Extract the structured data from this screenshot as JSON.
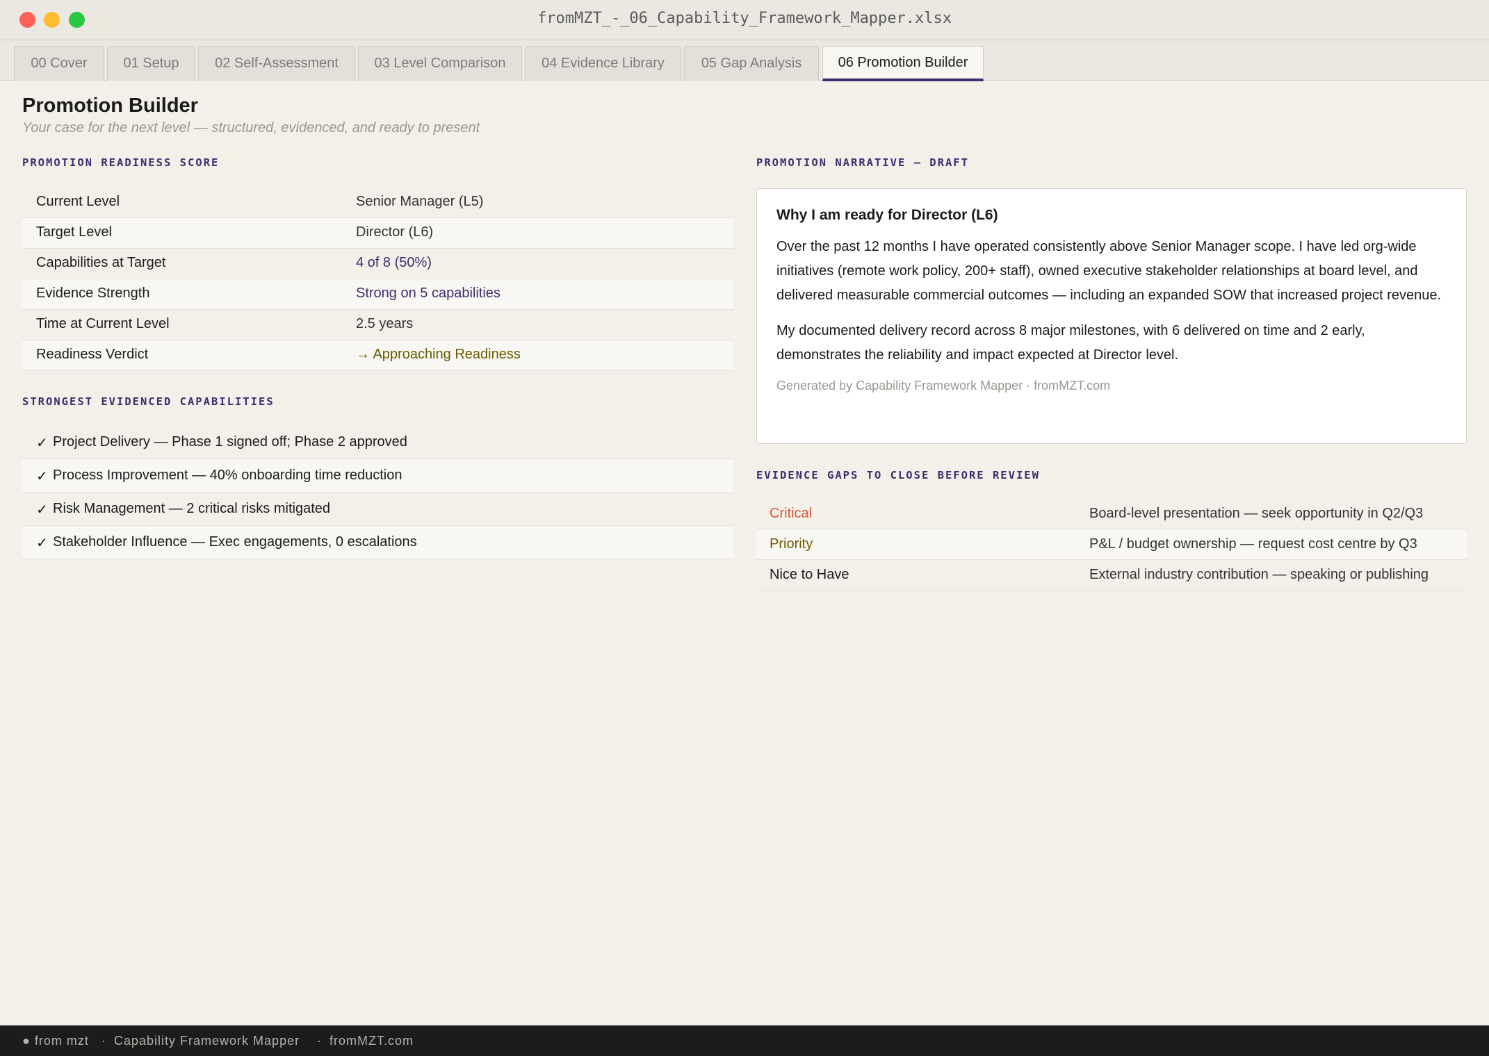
{
  "window": {
    "title": "fromMZT_-_06_Capability_Framework_Mapper.xlsx"
  },
  "tabs": [
    {
      "label": "00 Cover"
    },
    {
      "label": "01 Setup"
    },
    {
      "label": "02 Self-Assessment"
    },
    {
      "label": "03 Level Comparison"
    },
    {
      "label": "04 Evidence Library"
    },
    {
      "label": "05 Gap Analysis"
    },
    {
      "label": "06 Promotion Builder",
      "active": true
    }
  ],
  "header": {
    "title": "Promotion Builder",
    "subtitle": "Your case for the next level — structured, evidenced, and ready to present"
  },
  "readiness": {
    "section_label": "PROMOTION READINESS SCORE",
    "rows": [
      {
        "key": "Current Level",
        "value": "Senior Manager (L5)"
      },
      {
        "key": "Target Level",
        "value": "Director (L6)"
      },
      {
        "key": "Capabilities at Target",
        "value": "4 of 8 (50%)"
      },
      {
        "key": "Evidence Strength",
        "value": "Strong on 5 capabilities"
      },
      {
        "key": "Time at Current Level",
        "value": "2.5 years"
      },
      {
        "key": "Readiness Verdict",
        "value": "→ Approaching Readiness"
      }
    ]
  },
  "strengths": {
    "section_label": "STRONGEST EVIDENCED CAPABILITIES",
    "check_glyph": "✓",
    "items": [
      "Project Delivery — Phase 1 signed off; Phase 2 approved",
      "Process Improvement — 40% onboarding time reduction",
      "Risk Management — 2 critical risks mitigated",
      "Stakeholder Influence — Exec engagements, 0 escalations"
    ]
  },
  "narrative": {
    "section_label": "PROMOTION NARRATIVE — DRAFT",
    "heading": "Why I am ready for Director (L6)",
    "paragraphs": [
      "Over the past 12 months I have operated consistently above Senior Manager scope. I have led org-wide initiatives (remote work policy, 200+ staff), owned executive stakeholder relationships at board level, and delivered measurable commercial outcomes — including an expanded SOW that increased project revenue.",
      "My documented delivery record across 8 major milestones, with 6 delivered on time and 2 early, demonstrates the reliability and impact expected at Director level."
    ],
    "footer": "Generated by Capability Framework Mapper · fromMZT.com"
  },
  "gaps": {
    "section_label": "EVIDENCE GAPS TO CLOSE BEFORE REVIEW",
    "rows": [
      {
        "priority": "Critical",
        "gap": "Board-level presentation — seek opportunity in Q2/Q3",
        "color": "#d9573b"
      },
      {
        "priority": "Priority",
        "gap": "P&L / budget ownership — request cost centre by Q3",
        "color": "#6b5a00"
      },
      {
        "priority": "Nice to Have",
        "gap": "External industry contribution — speaking or publishing",
        "color": "#1b1b1b"
      }
    ]
  },
  "status_bar": {
    "brand": "● from mzt",
    "sep": "·",
    "app": "Capability Framework Mapper",
    "site": "fromMZT.com"
  },
  "colors": {
    "accent": "#3e2c70",
    "verdict": "#6b5a00",
    "critical": "#d9573b"
  }
}
